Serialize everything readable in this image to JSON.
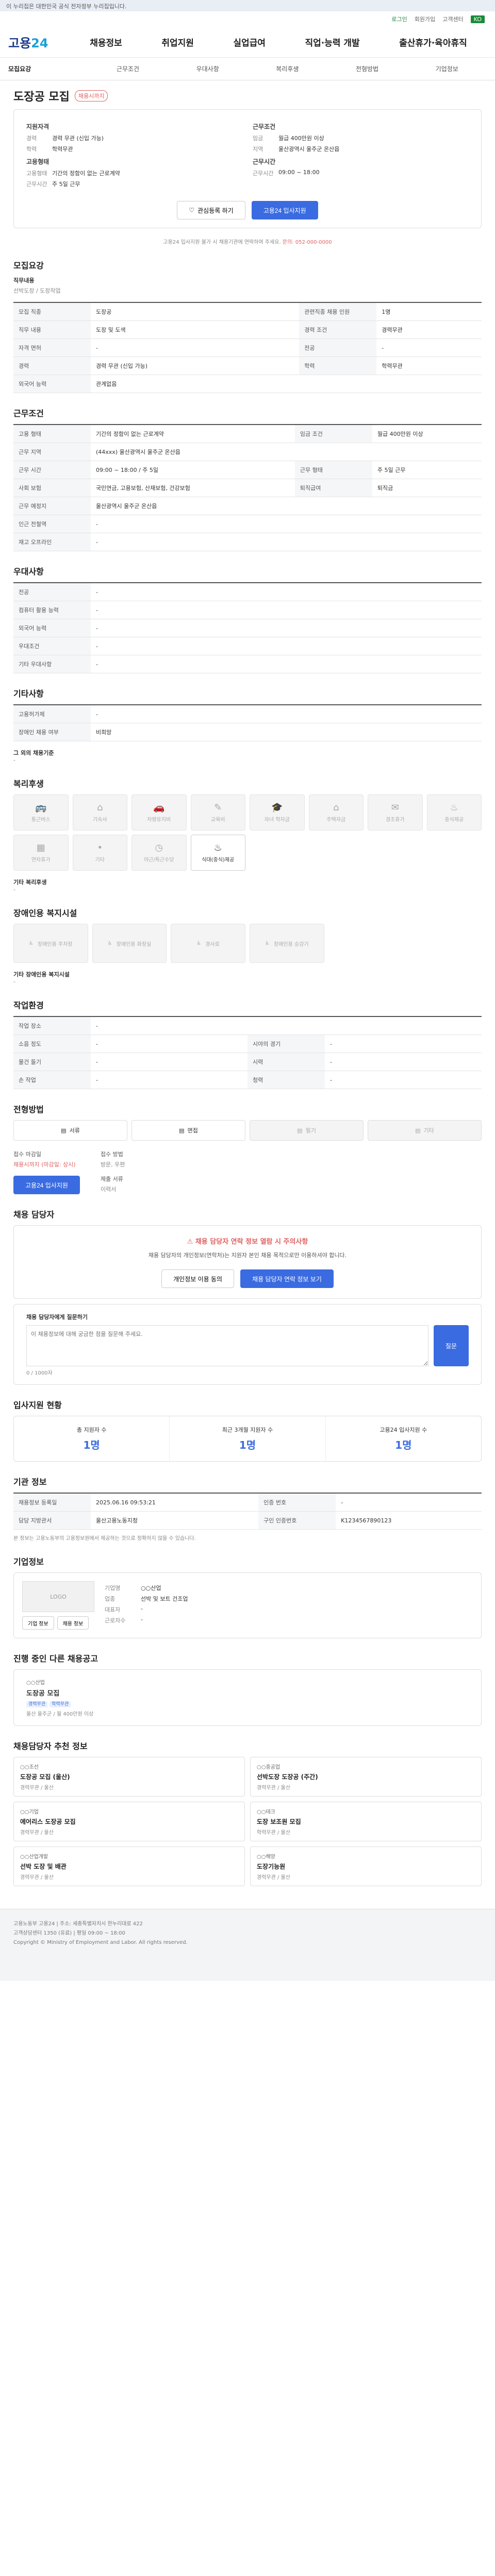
{
  "gov_bar": "이 누리집은 대한민국 공식 전자정부 누리집입니다.",
  "util": {
    "status": "로그인",
    "badge": "KO",
    "items": [
      "회원가입",
      "고객센터"
    ]
  },
  "logo": {
    "main": "고용",
    "accent": "24"
  },
  "menu": [
    "채용정보",
    "취업지원",
    "실업급여",
    "직업·능력 개발",
    "출산휴가·육아휴직"
  ],
  "tabs": [
    "모집요강",
    "근무조건",
    "우대사항",
    "복리후생",
    "전형방법",
    "기업정보"
  ],
  "job": {
    "title": "도장공 모집",
    "tag": "채용시까지",
    "left_head": "지원자격",
    "right_head": "근무조건",
    "left_rows": [
      [
        "경력",
        "경력 무관 (신입 가능)"
      ],
      [
        "학력",
        "학력무관"
      ]
    ],
    "right_rows": [
      [
        "임금",
        "월급 400만원 이상"
      ],
      [
        "지역",
        "울산광역시 울주군 온산읍"
      ]
    ],
    "left_head2": "고용형태",
    "right_head2": "근무시간",
    "left_rows2": [
      [
        "고용형태",
        "기간의 정함이 없는 근로계약"
      ],
      [
        "근무시간",
        "주 5일 근무"
      ]
    ],
    "right_rows2": [
      [
        "근무시간",
        "09:00 ~ 18:00"
      ]
    ],
    "btn_interest": "관심등록 하기",
    "btn_apply": "고용24 입사지원",
    "note_pre": "고용24 입사지원 불가 시 채용기관에 연락하여 주세요.",
    "note_red": "문의: 052-000-0000"
  },
  "recruit": {
    "header": "모집요강",
    "work_type_label": "직무내용",
    "work_type_val": "선박도장 / 도장작업",
    "rows": [
      [
        "모집 직종",
        "도장공",
        "관련직종 채용 인원",
        "1명"
      ],
      [
        "직무 내용",
        "도장 및 도색",
        "경력 조건",
        "경력무관"
      ],
      [
        "자격 면허",
        "-",
        "전공",
        "-"
      ],
      [
        "경력",
        "경력 무관 (신입 가능)",
        "학력",
        "학력무관"
      ],
      [
        "외국어 능력",
        "관계없음",
        "",
        ""
      ]
    ]
  },
  "conditions": {
    "header": "근무조건",
    "rows": [
      [
        "고용 형태",
        "기간의 정함이 없는 근로계약",
        "임금 조건",
        "월급 400만원 이상"
      ],
      [
        "근무 지역",
        "(44xxx) 울산광역시 울주군 온산읍",
        "",
        ""
      ],
      [
        "근무 시간",
        "09:00 ~ 18:00 / 주 5일",
        "근무 형태",
        "주 5일 근무"
      ],
      [
        "사회 보험",
        "국민연금, 고용보험, 산재보험, 건강보험",
        "퇴직급여",
        "퇴직금"
      ],
      [
        "근무 예정지",
        "울산광역시 울주군 온산읍",
        "",
        ""
      ],
      [
        "인근 전철역",
        "-",
        "",
        ""
      ],
      [
        "재고 오프라인",
        "-",
        "",
        ""
      ]
    ]
  },
  "preference": {
    "header": "우대사항",
    "rows": [
      [
        "전공",
        "-"
      ],
      [
        "컴퓨터 활용 능력",
        "-"
      ],
      [
        "외국어 능력",
        "-"
      ],
      [
        "우대조건",
        "-"
      ],
      [
        "기타 우대사항",
        "-"
      ]
    ]
  },
  "other": {
    "header": "기타사항",
    "rows": [
      [
        "고용허가제",
        "-"
      ],
      [
        "장애인 채용 여부",
        "비희망"
      ]
    ],
    "extra_label": "그 외의 채용기준",
    "extra_val": "-"
  },
  "welfare": {
    "header": "복리후생",
    "items": [
      {
        "name": "통근버스",
        "icon": "bus-icon",
        "on": false
      },
      {
        "name": "기숙사",
        "icon": "home-icon",
        "on": false
      },
      {
        "name": "차량유지비",
        "icon": "car-icon",
        "on": false
      },
      {
        "name": "교육비",
        "icon": "book-icon",
        "on": false
      },
      {
        "name": "자녀 학자금",
        "icon": "cap-icon",
        "on": false
      },
      {
        "name": "주택자금",
        "icon": "house-icon",
        "on": false
      },
      {
        "name": "경조휴가",
        "icon": "gift-icon",
        "on": false
      },
      {
        "name": "중식제공",
        "icon": "meal-icon",
        "on": false
      },
      {
        "name": "연차휴가",
        "icon": "calendar-icon",
        "on": false
      },
      {
        "name": "기타",
        "icon": "dot-icon",
        "on": false
      },
      {
        "name": "야근/특근수당",
        "icon": "clock-icon",
        "on": false
      },
      {
        "name": "식대(중식)제공",
        "icon": "food-icon",
        "on": true
      }
    ],
    "other_label": "기타 복리후생",
    "other_val": "-"
  },
  "facility": {
    "header": "장애인용 복지시설",
    "items": [
      "장애인용 주차장",
      "장애인용 화장실",
      "경사로",
      "장애인용 승강기"
    ],
    "other_label": "기타 장애인용 복지시설",
    "other_val": "-"
  },
  "work_env": {
    "header": "작업환경",
    "rows": [
      [
        "작업 장소",
        "-",
        "",
        ""
      ],
      [
        "소음 정도",
        "-",
        "시야의 경기",
        "-"
      ],
      [
        "물건 들기",
        "-",
        "시력",
        "-"
      ],
      [
        "손 작업",
        "-",
        "청력",
        "-"
      ]
    ]
  },
  "selection": {
    "header": "전형방법",
    "methods": [
      {
        "name": "서류",
        "off": false
      },
      {
        "name": "면접",
        "off": false
      },
      {
        "name": "필기",
        "off": true
      },
      {
        "name": "기타",
        "off": true
      }
    ],
    "deadline_label": "접수 마감일",
    "deadline_val": "채용시까지 (마감일: 상시)",
    "apply_label": "접수 방법",
    "apply_val": "방문, 우편",
    "docs_label": "제출 서류",
    "docs_val": "이력서",
    "btn_apply": "고용24 입사지원"
  },
  "contact": {
    "header": "채용 담당자",
    "alert_title": "채용 담당자 연락 정보 열람 시 주의사항",
    "alert_text": "채용 담당자의 개인정보(연락처)는 지원자 본인 채용 목적으로만 이용하셔야 합니다.",
    "btn_left": "개인정보 이용 동의",
    "btn_right": "채용 담당자 연락 정보 보기",
    "review_label": "채용 담당자에게 질문하기",
    "review_placeholder": "이 채용정보에 대해 궁금한 점을 질문해 주세요.",
    "review_count": "0 / 1000자",
    "btn_submit": "질문"
  },
  "stats": {
    "header": "입사지원 현황",
    "items": [
      {
        "label": "총 지원자 수",
        "value": "1명"
      },
      {
        "label": "최근 3개월 지원자 수",
        "value": "1명"
      },
      {
        "label": "고용24 입사지원 수",
        "value": "1명"
      }
    ]
  },
  "info": {
    "header": "기관 정보",
    "rows": [
      [
        "채용정보 등록일",
        "2025.06.16 09:53:21",
        "인증 번호",
        "-"
      ],
      [
        "담당 지방관서",
        "울산고용노동지청",
        "구인 인증번호",
        "K1234567890123"
      ]
    ],
    "note": "본 정보는 고용노동부의 고용정보원에서 제공하는 것으로 정확하지 않을 수 있습니다."
  },
  "company": {
    "header": "기업정보",
    "logo_text": "LOGO",
    "rows": [
      [
        "기업명",
        "○○산업"
      ],
      [
        "업종",
        "선박 및 보트 건조업"
      ],
      [
        "대표자",
        "-"
      ],
      [
        "근로자수",
        "-"
      ]
    ],
    "btn_left": "기업 정보",
    "btn_right": "채용 정보"
  },
  "similar": {
    "header": "진행 중인 다른 채용공고",
    "card": {
      "co": "○○산업",
      "title": "도장공 모집",
      "chips": [
        "경력무관",
        "학력무관"
      ],
      "meta": "울산 울주군 / 월 400만원 이상"
    }
  },
  "recommend": {
    "header": "채용담당자 추천 정보",
    "cards": [
      {
        "co": "○○조선",
        "title": "도장공 모집 (울산)",
        "meta": "경력무관 / 울산"
      },
      {
        "co": "○○중공업",
        "title": "선박도장 도장공 (주간)",
        "meta": "경력무관 / 울산"
      },
      {
        "co": "○○기업",
        "title": "에어리스 도장공 모집",
        "meta": "경력무관 / 울산"
      },
      {
        "co": "○○테크",
        "title": "도장 보조원 모집",
        "meta": "학력무관 / 울산"
      },
      {
        "co": "○○산업개발",
        "title": "선박 도장 및 배관",
        "meta": "경력무관 / 울산"
      },
      {
        "co": "○○해양",
        "title": "도장기능원",
        "meta": "경력무관 / 울산"
      }
    ]
  },
  "footer": {
    "lines": [
      "고용노동부 고용24  |  주소: 세종특별자치시 한누리대로 422",
      "고객상담센터 1350 (유료)  |  평일 09:00 ~ 18:00",
      "Copyright © Ministry of Employment and Labor. All rights reserved."
    ]
  }
}
